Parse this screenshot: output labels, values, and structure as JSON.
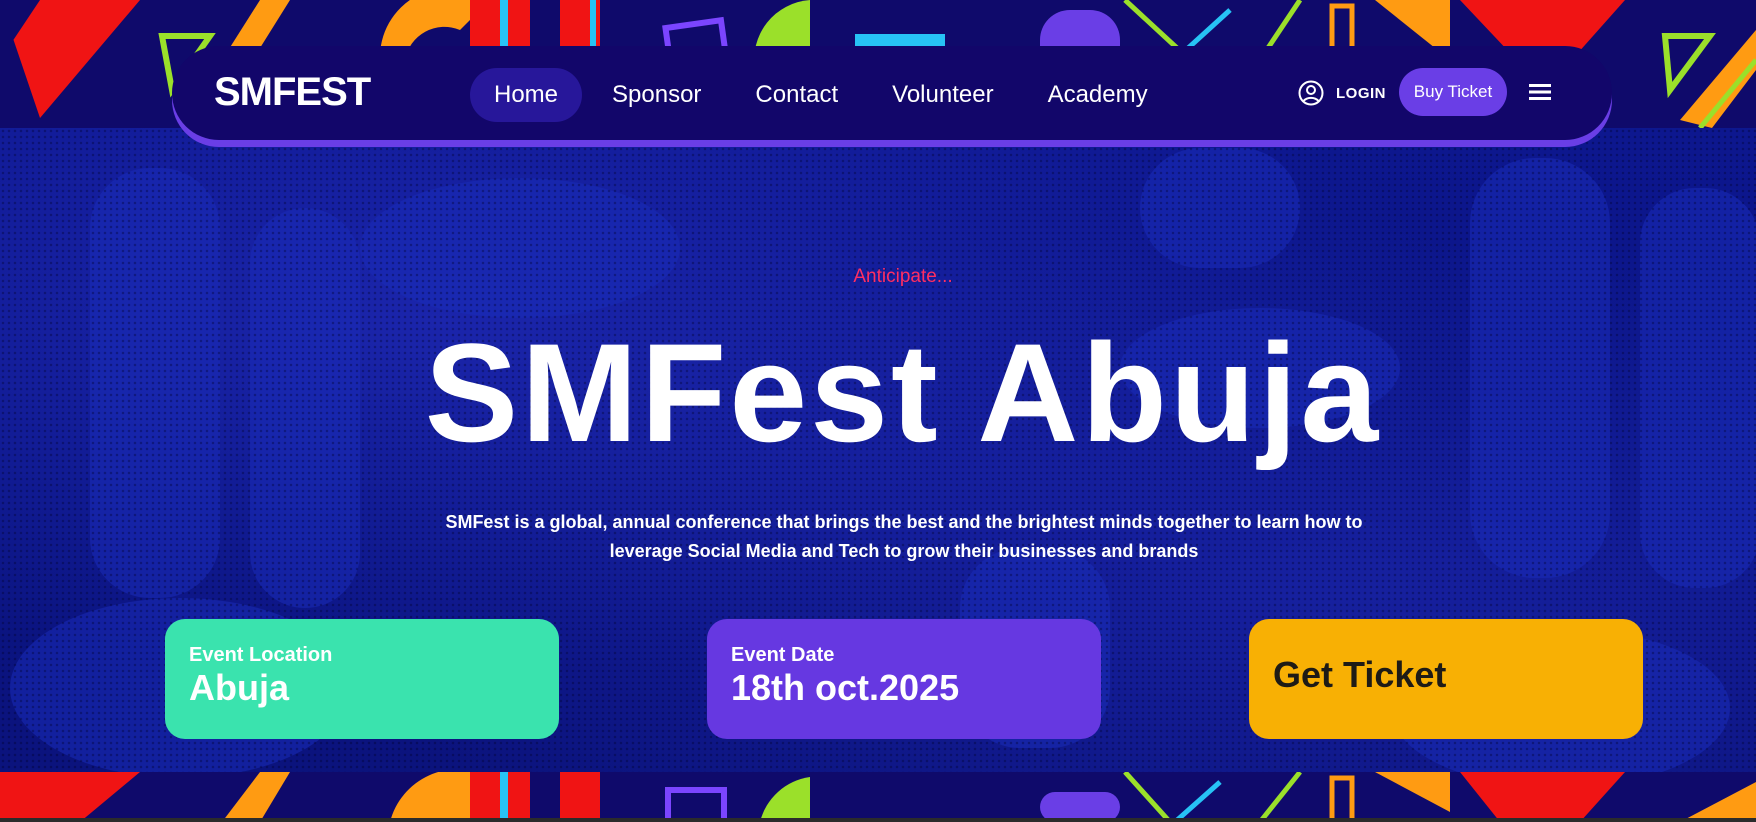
{
  "brand": {
    "logo": "SMFEST"
  },
  "nav": {
    "items": [
      {
        "label": "Home",
        "active": true
      },
      {
        "label": "Sponsor",
        "active": false
      },
      {
        "label": "Contact",
        "active": false
      },
      {
        "label": "Volunteer",
        "active": false
      },
      {
        "label": "Academy",
        "active": false
      }
    ],
    "login_label": "LOGIN",
    "buy_ticket_label": "Buy Ticket",
    "icons": {
      "login": "user-circle-icon",
      "menu": "hamburger-menu-icon"
    }
  },
  "hero": {
    "eyebrow": "Anticipate...",
    "title": "SMFest Abuja",
    "description": "SMFest is a global, annual conference that brings the best and the brightest minds together to learn how to leverage Social Media and Tech to grow their businesses and brands"
  },
  "cards": {
    "location": {
      "label": "Event Location",
      "value": "Abuja"
    },
    "date": {
      "label": "Event Date",
      "value": "18th oct.2025"
    },
    "ticket": {
      "label": "Get Ticket"
    }
  },
  "colors": {
    "navbar": "#12066a",
    "accent_purple": "#6a3ee6",
    "eyebrow": "#ff2e63",
    "card_location": "#3ae3ae",
    "card_date": "#6638e1",
    "card_ticket": "#f8b004"
  }
}
